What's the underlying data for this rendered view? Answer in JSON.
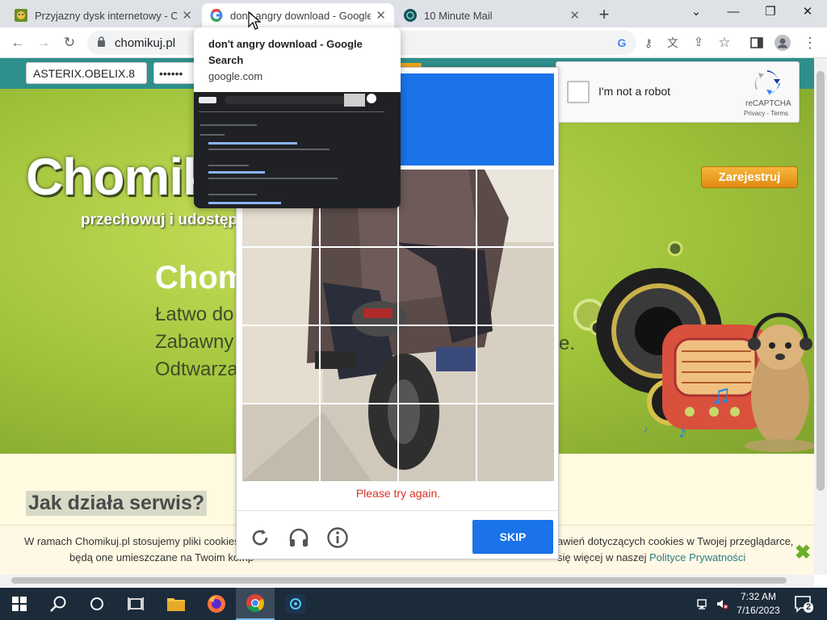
{
  "browser": {
    "tabs": [
      {
        "title": "Przyjazny dysk internetowy - Cho",
        "close": "✕"
      },
      {
        "title": "don't angry download - Google S",
        "close": "✕"
      },
      {
        "title": "10 Minute Mail",
        "close": "✕"
      }
    ],
    "new_tab": "+",
    "window": {
      "minimize": "—",
      "maximize": "❐",
      "close": "✕",
      "tab_search": "⌄"
    },
    "url": "chomikuj.pl",
    "tooltip": {
      "title": "don't angry download - Google Search",
      "domain": "google.com"
    }
  },
  "page": {
    "login_value": "ASTERIX.OBELIX.8",
    "password_mask": "••••••",
    "brand": "Chomiku",
    "tagline": "przechowuj i udostępni",
    "heading": "Chom",
    "features": [
      "Łatwo do",
      "Zabawny",
      "Odtwarza"
    ],
    "feature_tail": "e.",
    "register_button": "Zarejestruj",
    "how_heading": "Jak działa serwis?",
    "cookie": {
      "line1_left": "W ramach Chomikuj.pl stosujemy pliki cookies",
      "line1_right": "awień dotyczących cookies w Twojej przeglądarce,",
      "line2_left": "będą one umieszczane na Twoim komp",
      "line2_right": "się więcej w naszej",
      "link": "Polityce Prywatności",
      "close": "✖"
    }
  },
  "recaptcha": {
    "checkbox_label": "I'm not a robot",
    "brand": "reCAPTCHA",
    "privacy": "Privacy",
    "terms": "Terms",
    "error": "Please try again.",
    "skip": "SKIP",
    "grid_size": 4
  },
  "taskbar": {
    "time": "7:32 AM",
    "date": "7/16/2023",
    "notification_count": "2"
  }
}
